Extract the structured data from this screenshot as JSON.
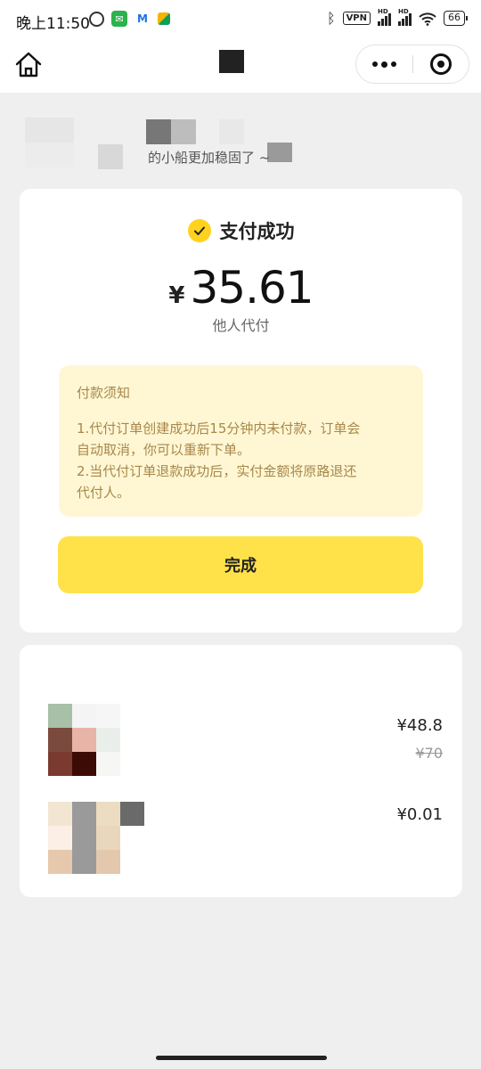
{
  "status_bar": {
    "time": "晚上11:50",
    "vpn": "VPN",
    "hd": "HD",
    "battery": "66"
  },
  "nav": {
    "home_icon": "home-icon",
    "more_icon": "more-icon",
    "close_icon": "target-close-icon"
  },
  "banner": {
    "text": "的小船更加稳固了 ~"
  },
  "payment": {
    "status": "支付成功",
    "currency": "¥",
    "amount": "35.61",
    "type": "他人代付",
    "notice_title": "付款须知",
    "notice_lines": [
      "1.代付订单创建成功后15分钟内未付款，订单会",
      "自动取消，你可以重新下单。",
      "2.当代付订单退款成功后，实付金额将原路退还",
      "代付人。"
    ],
    "done_label": "完成",
    "accent": "#ffe24a"
  },
  "items": [
    {
      "price": "¥48.8",
      "original_price": "¥70"
    },
    {
      "price": "¥0.01"
    }
  ]
}
